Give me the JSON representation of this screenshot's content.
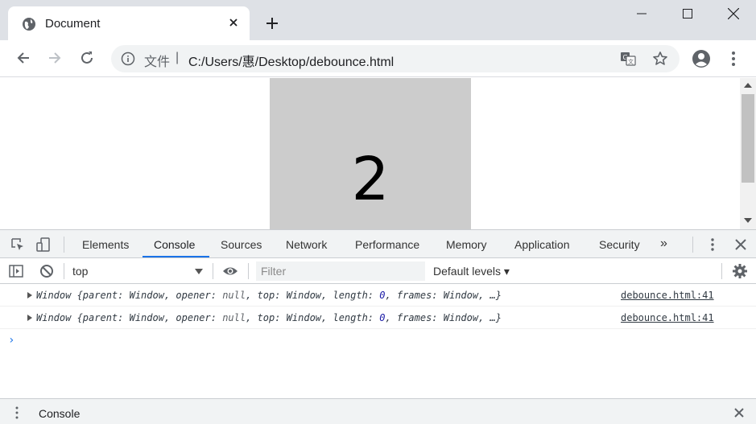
{
  "window": {
    "tab_title": "Document"
  },
  "toolbar": {
    "scheme_label": "文件",
    "separator": "|",
    "url": "C:/Users/惠/Desktop/debounce.html"
  },
  "page": {
    "box_number": "2",
    "box_color": "#cccccc"
  },
  "devtools": {
    "tabs": [
      {
        "label": "Elements"
      },
      {
        "label": "Console"
      },
      {
        "label": "Sources"
      },
      {
        "label": "Network"
      },
      {
        "label": "Performance"
      },
      {
        "label": "Memory"
      },
      {
        "label": "Application"
      },
      {
        "label": "Security"
      }
    ],
    "active_tab": "Console",
    "more_tabs": "»",
    "context": "top",
    "filter_placeholder": "Filter",
    "levels": "Default levels ▾",
    "messages": [
      {
        "prefix": "Window {parent: Window, opener: ",
        "null": "null",
        "mid": ", top: Window, length: ",
        "num": "0",
        "suffix": ", frames: Window, …}",
        "source": "debounce.html:41"
      },
      {
        "prefix": "Window {parent: Window, opener: ",
        "null": "null",
        "mid": ", top: Window, length: ",
        "num": "0",
        "suffix": ", frames: Window, …}",
        "source": "debounce.html:41"
      }
    ],
    "prompt": "›",
    "drawer_title": "Console"
  },
  "colors": {
    "accent": "#1a73e8",
    "chrome_frame": "#dee1e6"
  }
}
